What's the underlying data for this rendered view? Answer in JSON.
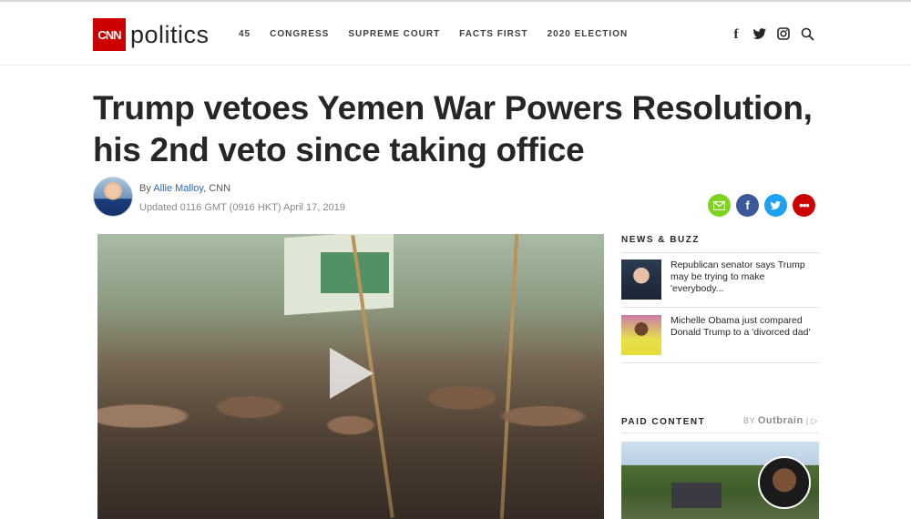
{
  "header": {
    "logo_box": "CNN",
    "brand": "politics",
    "nav": [
      "45",
      "CONGRESS",
      "SUPREME COURT",
      "FACTS FIRST",
      "2020 ELECTION"
    ],
    "social_icons": [
      "facebook-icon",
      "twitter-icon",
      "instagram-icon",
      "search-icon"
    ]
  },
  "article": {
    "headline_line1": "Trump vetoes Yemen War Powers Resolution,",
    "headline_line2": "his 2nd veto since taking office",
    "by": "By",
    "author": "Allie Malloy",
    "outlet": ", CNN",
    "updated": "Updated 0116 GMT (0916 HKT) April 17, 2019",
    "share_icons": [
      "email-icon",
      "facebook-icon",
      "twitter-icon",
      "more-icon"
    ]
  },
  "sidebar": {
    "news_title": "NEWS & BUZZ",
    "news_items": [
      {
        "text": "Republican senator says Trump may be trying to make 'everybody..."
      },
      {
        "text": "Michelle Obama just compared Donald Trump to a 'divorced dad'"
      }
    ],
    "paid_title": "PAID CONTENT",
    "by_label": "BY",
    "outbrain": "Outbrain",
    "outbrain_mark": "| ▷"
  },
  "colors": {
    "cnn_red": "#cc0000",
    "author_link": "#2b67b3"
  }
}
